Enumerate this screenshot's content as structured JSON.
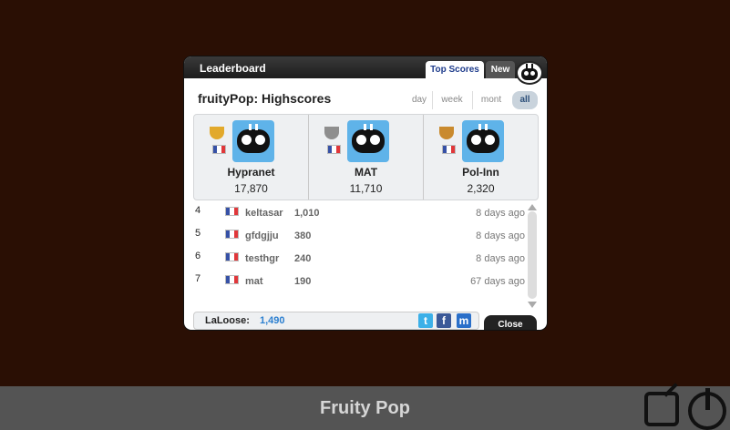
{
  "modal": {
    "title": "Leaderboard",
    "tabs": [
      "Top Scores",
      "New"
    ],
    "heading": "fruityPop: Highscores",
    "periods": [
      "day",
      "week",
      "mont",
      "all"
    ],
    "close_label": "Close"
  },
  "podium": [
    {
      "name": "Hypranet",
      "score": "17,870",
      "trophy": "gold"
    },
    {
      "name": "MAT",
      "score": "11,710",
      "trophy": "silver"
    },
    {
      "name": "Pol-Inn",
      "score": "2,320",
      "trophy": "bronze"
    }
  ],
  "rows": [
    {
      "rank": "4",
      "name": "keltasar",
      "score": "1,010",
      "when": "8 days ago"
    },
    {
      "rank": "5",
      "name": "gfdgjju",
      "score": "380",
      "when": "8 days ago"
    },
    {
      "rank": "6",
      "name": "testhgr",
      "score": "240",
      "when": "8 days ago"
    },
    {
      "rank": "7",
      "name": "mat",
      "score": "190",
      "when": "67 days ago"
    }
  ],
  "self": {
    "name": "LaLoose:",
    "score": "1,490"
  },
  "game": {
    "title": "Fruity Pop"
  },
  "colors": {
    "background": "#2a0f04",
    "accent": "#2b7fd0",
    "bar": "#545454"
  }
}
